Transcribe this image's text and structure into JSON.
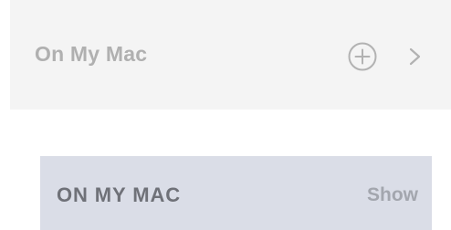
{
  "sidebar_row": {
    "label": "On My Mac",
    "add_icon": "plus-circle-icon",
    "disclosure_icon": "chevron-right-icon"
  },
  "section_header": {
    "label": "ON MY MAC",
    "show_label": "Show"
  },
  "colors": {
    "row_background": "#f4f4f4",
    "row_text": "#b0b0b0",
    "icon_color": "#b2b2b2",
    "header_background": "#dadde7",
    "header_text": "#6f7178",
    "show_text": "#a3a6ae"
  }
}
